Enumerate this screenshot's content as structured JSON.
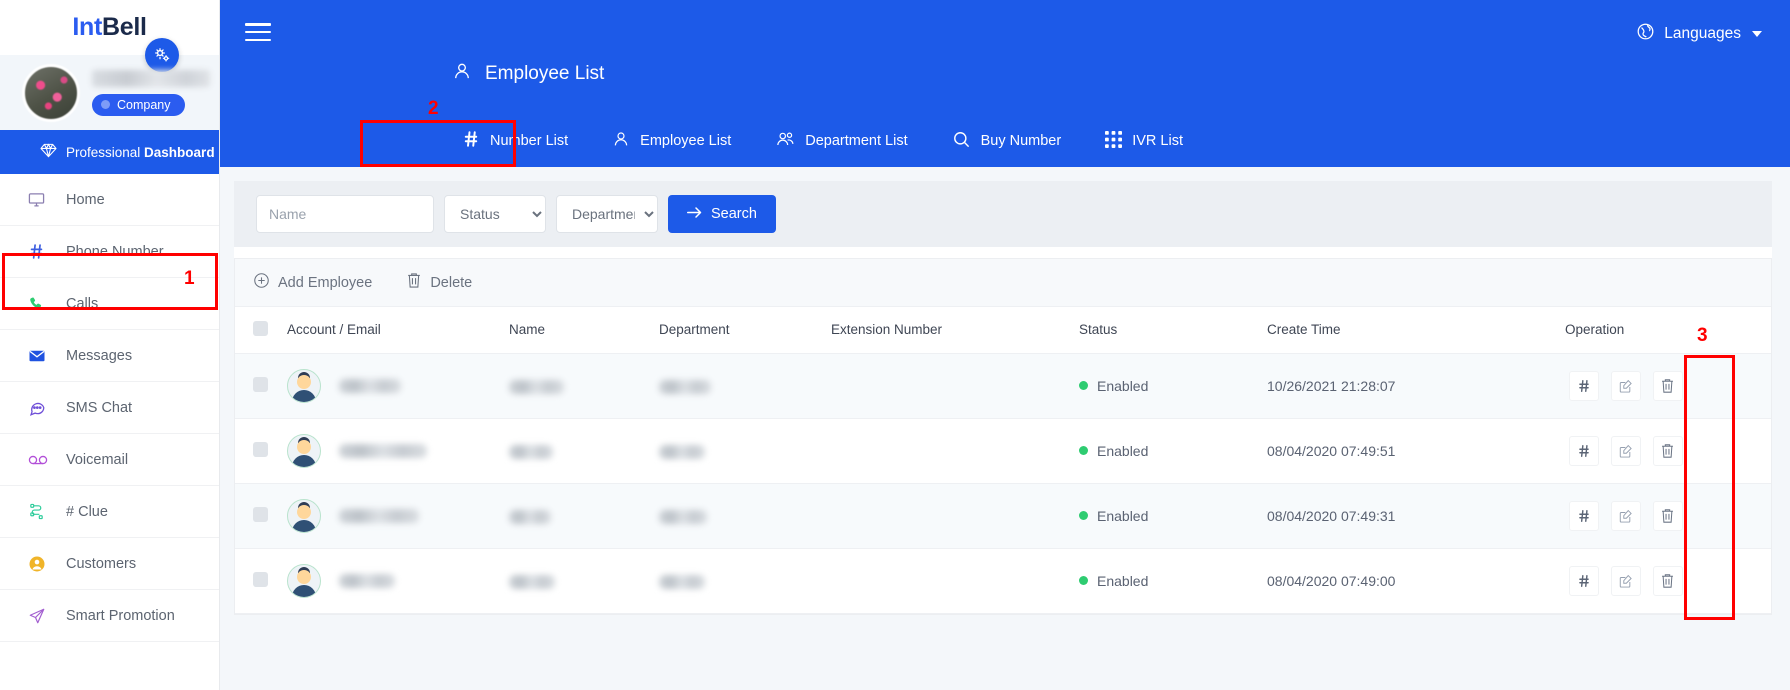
{
  "brand": {
    "part1": "Int",
    "part2": "Bell"
  },
  "sidebar": {
    "gear_icon": "gears-icon",
    "company_badge": "Company",
    "pro_dashboard": {
      "prefix": "Professional ",
      "strong": "Dashboard",
      "icon": "diamond-icon"
    },
    "items": [
      {
        "label": "Home",
        "icon": "monitor-icon"
      },
      {
        "label": "Phone Number",
        "icon": "hash-icon"
      },
      {
        "label": "Calls",
        "icon": "phone-icon"
      },
      {
        "label": "Messages",
        "icon": "envelope-icon"
      },
      {
        "label": "SMS Chat",
        "icon": "chat-bubble-icon"
      },
      {
        "label": "Voicemail",
        "icon": "voicemail-icon"
      },
      {
        "label": "# Clue",
        "icon": "flow-icon"
      },
      {
        "label": "Customers",
        "icon": "user-circle-icon"
      },
      {
        "label": "Smart Promotion",
        "icon": "paper-plane-icon"
      }
    ]
  },
  "topbar": {
    "menu_icon": "hamburger-icon",
    "language": {
      "label": "Languages",
      "icon": "globe-icon"
    },
    "page_title": {
      "label": "Employee List",
      "icon": "user-icon"
    },
    "tabs": [
      {
        "label": "Number List",
        "icon": "hash-icon",
        "active": false
      },
      {
        "label": "Employee List",
        "icon": "user-icon",
        "active": true
      },
      {
        "label": "Department List",
        "icon": "users-icon",
        "active": false
      },
      {
        "label": "Buy Number",
        "icon": "search-icon",
        "active": false
      },
      {
        "label": "IVR List",
        "icon": "grid-icon",
        "active": false
      }
    ]
  },
  "filters": {
    "name": {
      "value": "",
      "placeholder": "Name"
    },
    "status": {
      "selected": "Status"
    },
    "department": {
      "selected": "Department"
    },
    "search_button": {
      "label": "Search",
      "icon": "arrow-right-icon"
    }
  },
  "table_toolbar": {
    "add": {
      "label": "Add Employee",
      "icon": "plus-circle-icon"
    },
    "delete": {
      "label": "Delete",
      "icon": "trash-icon"
    }
  },
  "table": {
    "columns": [
      "",
      "Account / Email",
      "Name",
      "Department",
      "Extension Number",
      "Status",
      "Create Time",
      "Operation"
    ],
    "rows": [
      {
        "account": "",
        "name": "",
        "department": "",
        "extension": "",
        "status": "Enabled",
        "create_time": "10/26/2021 21:28:07"
      },
      {
        "account": "",
        "name": "",
        "department": "",
        "extension": "",
        "status": "Enabled",
        "create_time": "08/04/2020 07:49:51"
      },
      {
        "account": "",
        "name": "",
        "department": "",
        "extension": "",
        "status": "Enabled",
        "create_time": "08/04/2020 07:49:31"
      },
      {
        "account": "",
        "name": "",
        "department": "",
        "extension": "",
        "status": "Enabled",
        "create_time": "08/04/2020 07:49:00"
      }
    ],
    "operation_icons": [
      "hash-icon",
      "edit-icon",
      "trash-icon"
    ]
  },
  "annotations": [
    {
      "number": "1",
      "target": "sidebar-item-phone-number"
    },
    {
      "number": "2",
      "target": "tab-employee-list"
    },
    {
      "number": "3",
      "target": "operation-delete-column"
    }
  ],
  "colors": {
    "brand_blue": "#1d5ae8",
    "accent_blue": "#2b5cf0",
    "status_green": "#2ecc71",
    "annotation_red": "#ff0000"
  }
}
